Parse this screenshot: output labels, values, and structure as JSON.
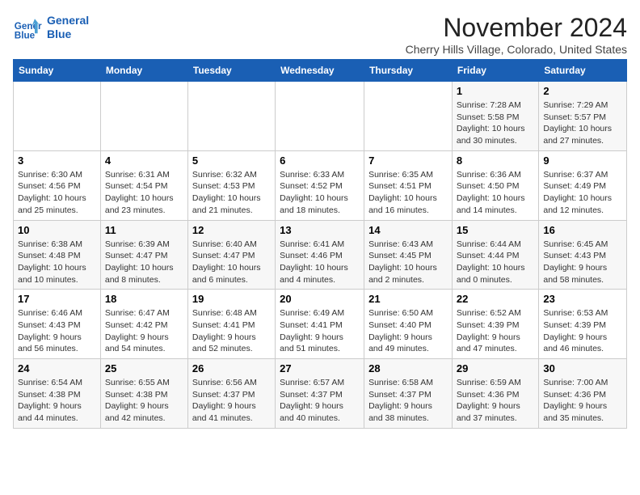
{
  "app": {
    "logo_line1": "General",
    "logo_line2": "Blue"
  },
  "header": {
    "month": "November 2024",
    "location": "Cherry Hills Village, Colorado, United States"
  },
  "weekdays": [
    "Sunday",
    "Monday",
    "Tuesday",
    "Wednesday",
    "Thursday",
    "Friday",
    "Saturday"
  ],
  "weeks": [
    [
      {
        "day": "",
        "info": ""
      },
      {
        "day": "",
        "info": ""
      },
      {
        "day": "",
        "info": ""
      },
      {
        "day": "",
        "info": ""
      },
      {
        "day": "",
        "info": ""
      },
      {
        "day": "1",
        "info": "Sunrise: 7:28 AM\nSunset: 5:58 PM\nDaylight: 10 hours and 30 minutes."
      },
      {
        "day": "2",
        "info": "Sunrise: 7:29 AM\nSunset: 5:57 PM\nDaylight: 10 hours and 27 minutes."
      }
    ],
    [
      {
        "day": "3",
        "info": "Sunrise: 6:30 AM\nSunset: 4:56 PM\nDaylight: 10 hours and 25 minutes."
      },
      {
        "day": "4",
        "info": "Sunrise: 6:31 AM\nSunset: 4:54 PM\nDaylight: 10 hours and 23 minutes."
      },
      {
        "day": "5",
        "info": "Sunrise: 6:32 AM\nSunset: 4:53 PM\nDaylight: 10 hours and 21 minutes."
      },
      {
        "day": "6",
        "info": "Sunrise: 6:33 AM\nSunset: 4:52 PM\nDaylight: 10 hours and 18 minutes."
      },
      {
        "day": "7",
        "info": "Sunrise: 6:35 AM\nSunset: 4:51 PM\nDaylight: 10 hours and 16 minutes."
      },
      {
        "day": "8",
        "info": "Sunrise: 6:36 AM\nSunset: 4:50 PM\nDaylight: 10 hours and 14 minutes."
      },
      {
        "day": "9",
        "info": "Sunrise: 6:37 AM\nSunset: 4:49 PM\nDaylight: 10 hours and 12 minutes."
      }
    ],
    [
      {
        "day": "10",
        "info": "Sunrise: 6:38 AM\nSunset: 4:48 PM\nDaylight: 10 hours and 10 minutes."
      },
      {
        "day": "11",
        "info": "Sunrise: 6:39 AM\nSunset: 4:47 PM\nDaylight: 10 hours and 8 minutes."
      },
      {
        "day": "12",
        "info": "Sunrise: 6:40 AM\nSunset: 4:47 PM\nDaylight: 10 hours and 6 minutes."
      },
      {
        "day": "13",
        "info": "Sunrise: 6:41 AM\nSunset: 4:46 PM\nDaylight: 10 hours and 4 minutes."
      },
      {
        "day": "14",
        "info": "Sunrise: 6:43 AM\nSunset: 4:45 PM\nDaylight: 10 hours and 2 minutes."
      },
      {
        "day": "15",
        "info": "Sunrise: 6:44 AM\nSunset: 4:44 PM\nDaylight: 10 hours and 0 minutes."
      },
      {
        "day": "16",
        "info": "Sunrise: 6:45 AM\nSunset: 4:43 PM\nDaylight: 9 hours and 58 minutes."
      }
    ],
    [
      {
        "day": "17",
        "info": "Sunrise: 6:46 AM\nSunset: 4:43 PM\nDaylight: 9 hours and 56 minutes."
      },
      {
        "day": "18",
        "info": "Sunrise: 6:47 AM\nSunset: 4:42 PM\nDaylight: 9 hours and 54 minutes."
      },
      {
        "day": "19",
        "info": "Sunrise: 6:48 AM\nSunset: 4:41 PM\nDaylight: 9 hours and 52 minutes."
      },
      {
        "day": "20",
        "info": "Sunrise: 6:49 AM\nSunset: 4:41 PM\nDaylight: 9 hours and 51 minutes."
      },
      {
        "day": "21",
        "info": "Sunrise: 6:50 AM\nSunset: 4:40 PM\nDaylight: 9 hours and 49 minutes."
      },
      {
        "day": "22",
        "info": "Sunrise: 6:52 AM\nSunset: 4:39 PM\nDaylight: 9 hours and 47 minutes."
      },
      {
        "day": "23",
        "info": "Sunrise: 6:53 AM\nSunset: 4:39 PM\nDaylight: 9 hours and 46 minutes."
      }
    ],
    [
      {
        "day": "24",
        "info": "Sunrise: 6:54 AM\nSunset: 4:38 PM\nDaylight: 9 hours and 44 minutes."
      },
      {
        "day": "25",
        "info": "Sunrise: 6:55 AM\nSunset: 4:38 PM\nDaylight: 9 hours and 42 minutes."
      },
      {
        "day": "26",
        "info": "Sunrise: 6:56 AM\nSunset: 4:37 PM\nDaylight: 9 hours and 41 minutes."
      },
      {
        "day": "27",
        "info": "Sunrise: 6:57 AM\nSunset: 4:37 PM\nDaylight: 9 hours and 40 minutes."
      },
      {
        "day": "28",
        "info": "Sunrise: 6:58 AM\nSunset: 4:37 PM\nDaylight: 9 hours and 38 minutes."
      },
      {
        "day": "29",
        "info": "Sunrise: 6:59 AM\nSunset: 4:36 PM\nDaylight: 9 hours and 37 minutes."
      },
      {
        "day": "30",
        "info": "Sunrise: 7:00 AM\nSunset: 4:36 PM\nDaylight: 9 hours and 35 minutes."
      }
    ]
  ]
}
